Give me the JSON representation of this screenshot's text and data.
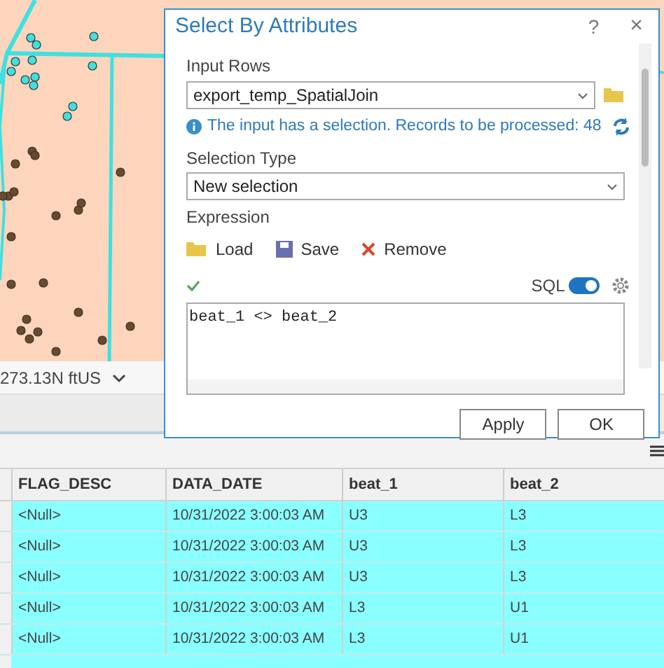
{
  "status_bar": {
    "coordinates": "273.13N ftUS"
  },
  "dialog": {
    "title": "Select By Attributes",
    "help": "?",
    "close": "×",
    "input_rows": {
      "label": "Input Rows",
      "value": "export_temp_SpatialJoin"
    },
    "info": "The input has a selection. Records to be processed: 48",
    "selection_type": {
      "label": "Selection Type",
      "value": "New selection"
    },
    "expression": {
      "label": "Expression",
      "actions": [
        {
          "kind": "load",
          "label": "Load"
        },
        {
          "kind": "save",
          "label": "Save"
        },
        {
          "kind": "remove",
          "label": "Remove"
        }
      ],
      "valid": true,
      "sql_label": "SQL",
      "sql_on": true,
      "text": "beat_1 <> beat_2"
    },
    "buttons": [
      "Apply",
      "OK"
    ]
  },
  "table": {
    "columns": [
      "FLAG_DESC",
      "DATA_DATE",
      "beat_1",
      "beat_2"
    ],
    "rows": [
      {
        "selected": true,
        "cells": [
          "<Null>",
          "10/31/2022 3:00:03 AM",
          "U3",
          "L3"
        ]
      },
      {
        "selected": true,
        "cells": [
          "<Null>",
          "10/31/2022 3:00:03 AM",
          "U3",
          "L3"
        ]
      },
      {
        "selected": true,
        "cells": [
          "<Null>",
          "10/31/2022 3:00:03 AM",
          "U3",
          "L3"
        ]
      },
      {
        "selected": true,
        "cells": [
          "<Null>",
          "10/31/2022 3:00:03 AM",
          "L3",
          "U1"
        ]
      },
      {
        "selected": true,
        "cells": [
          "<Null>",
          "10/31/2022 3:00:03 AM",
          "L3",
          "U1"
        ]
      }
    ]
  }
}
